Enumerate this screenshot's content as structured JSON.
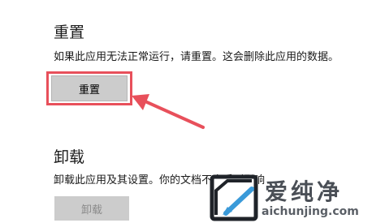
{
  "reset": {
    "title": "重置",
    "description": "如果此应用无法正常运行，请重置。这会删除此应用的数据。",
    "button_label": "重置"
  },
  "uninstall": {
    "title": "卸载",
    "description": "卸载此应用及其设置。你的文档不会受到影响",
    "button_label": "卸载"
  },
  "annotation": {
    "highlight_color": "#e8505b"
  },
  "watermark": {
    "name": "爱纯净",
    "url": "aichunjing.com"
  },
  "icons": {
    "arrow": "red-arrow-icon",
    "logo": "aichunjing-logo-icon"
  }
}
